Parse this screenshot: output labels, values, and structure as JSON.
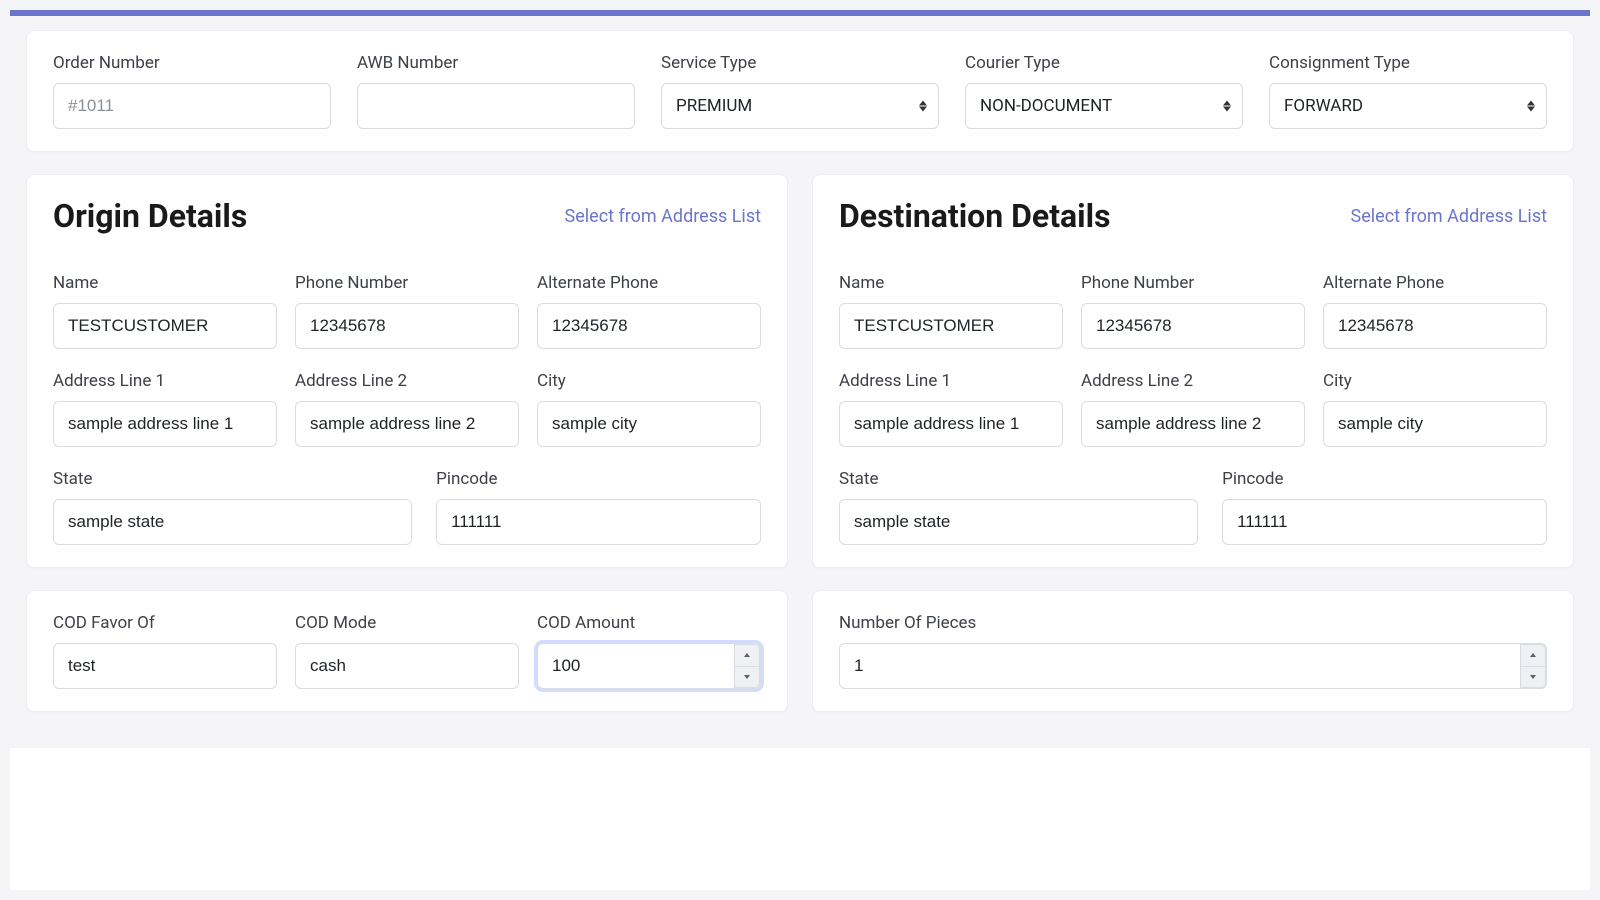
{
  "order": {
    "order_number_label": "Order Number",
    "order_number_placeholder": "#1011",
    "order_number_value": "",
    "awb_number_label": "AWB Number",
    "awb_number_value": "",
    "service_type_label": "Service Type",
    "service_type_value": "PREMIUM",
    "courier_type_label": "Courier Type",
    "courier_type_value": "NON-DOCUMENT",
    "consignment_type_label": "Consignment Type",
    "consignment_type_value": "FORWARD"
  },
  "origin": {
    "title": "Origin Details",
    "address_list_link": "Select from Address List",
    "name_label": "Name",
    "name_value": "TESTCUSTOMER",
    "phone_label": "Phone Number",
    "phone_value": "12345678",
    "alt_phone_label": "Alternate Phone",
    "alt_phone_value": "12345678",
    "addr1_label": "Address Line 1",
    "addr1_value": "sample address line 1",
    "addr2_label": "Address Line 2",
    "addr2_value": "sample address line 2",
    "city_label": "City",
    "city_value": "sample city",
    "state_label": "State",
    "state_value": "sample state",
    "pincode_label": "Pincode",
    "pincode_value": "111111"
  },
  "destination": {
    "title": "Destination Details",
    "address_list_link": "Select from Address List",
    "name_label": "Name",
    "name_value": "TESTCUSTOMER",
    "phone_label": "Phone Number",
    "phone_value": "12345678",
    "alt_phone_label": "Alternate Phone",
    "alt_phone_value": "12345678",
    "addr1_label": "Address Line 1",
    "addr1_value": "sample address line 1",
    "addr2_label": "Address Line 2",
    "addr2_value": "sample address line 2",
    "city_label": "City",
    "city_value": "sample city",
    "state_label": "State",
    "state_value": "sample state",
    "pincode_label": "Pincode",
    "pincode_value": "111111"
  },
  "cod": {
    "favor_label": "COD Favor Of",
    "favor_value": "test",
    "mode_label": "COD Mode",
    "mode_value": "cash",
    "amount_label": "COD Amount",
    "amount_value": "100"
  },
  "pieces": {
    "label": "Number Of Pieces",
    "value": "1"
  }
}
